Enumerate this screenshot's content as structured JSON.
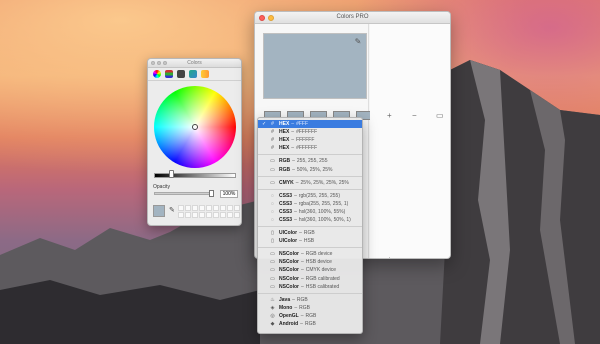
{
  "colors_panel": {
    "title": "Colors",
    "opacity_label": "Opacity",
    "opacity_value": "100%",
    "current_color": "#a3b4c1",
    "toolbar_icons": [
      "color-wheel-icon",
      "color-sliders-icon",
      "color-palettes-icon",
      "image-palettes-icon",
      "crayons-icon"
    ]
  },
  "pro_window": {
    "title": "Colors PRO",
    "preview_color": "#a3b4c1",
    "recent_colors": [
      "#a3b4c1",
      "#a3b4c1",
      "#a3b4c1",
      "#a3b4c1",
      "#a3b4c1"
    ],
    "add_label": "+",
    "remove_label": "−"
  },
  "menu": {
    "groups": [
      [
        {
          "icon": "#",
          "name": "HEX",
          "format": "#FFF",
          "selected": true
        },
        {
          "icon": "#",
          "name": "HEX",
          "format": "#FFFFFF",
          "selected": false
        },
        {
          "icon": "#",
          "name": "HEX",
          "format": "FFFFFF",
          "selected": false
        },
        {
          "icon": "#",
          "name": "HEX",
          "format": "#FFFFFF",
          "selected": false
        }
      ],
      [
        {
          "icon": "▭",
          "name": "RGB",
          "format": "255, 255, 255",
          "selected": false
        },
        {
          "icon": "▭",
          "name": "RGB",
          "format": "50%, 25%, 25%",
          "selected": false
        }
      ],
      [
        {
          "icon": "▭",
          "name": "CMYK",
          "format": "25%, 25%, 25%, 25%",
          "selected": false
        }
      ],
      [
        {
          "icon": "◌",
          "name": "CSS3",
          "format": "rgb(255, 255, 255)",
          "selected": false
        },
        {
          "icon": "◌",
          "name": "CSS3",
          "format": "rgba(255, 255, 255, 1)",
          "selected": false
        },
        {
          "icon": "◌",
          "name": "CSS3",
          "format": "hsl(360, 100%, 55%)",
          "selected": false
        },
        {
          "icon": "◌",
          "name": "CSS3",
          "format": "hsl(360, 100%, 50%, 1)",
          "selected": false
        }
      ],
      [
        {
          "icon": "▯",
          "name": "UIColor",
          "format": "RGB",
          "selected": false
        },
        {
          "icon": "▯",
          "name": "UIColor",
          "format": "HSB",
          "selected": false
        }
      ],
      [
        {
          "icon": "▭",
          "name": "NSColor",
          "format": "RGB device",
          "selected": false
        },
        {
          "icon": "▭",
          "name": "NSColor",
          "format": "HSB device",
          "selected": false
        },
        {
          "icon": "▭",
          "name": "NSColor",
          "format": "CMYK device",
          "selected": false
        },
        {
          "icon": "▭",
          "name": "NSColor",
          "format": "RGB calibrated",
          "selected": false
        },
        {
          "icon": "▭",
          "name": "NSColor",
          "format": "HSB calibrated",
          "selected": false
        }
      ],
      [
        {
          "icon": "♨",
          "name": "Java",
          "format": "RGB",
          "selected": false
        },
        {
          "icon": "◈",
          "name": "Mono",
          "format": "RGB",
          "selected": false
        },
        {
          "icon": "◎",
          "name": "OpenGL",
          "format": "RGB",
          "selected": false
        },
        {
          "icon": "◆",
          "name": "Android",
          "format": "RGB",
          "selected": false
        }
      ]
    ]
  }
}
